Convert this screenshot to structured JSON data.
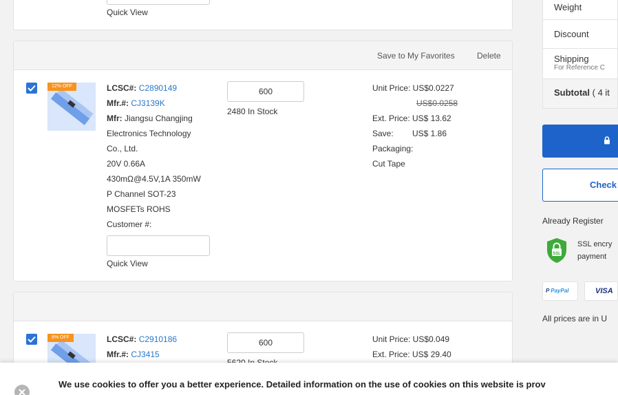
{
  "item0": {
    "quick_view": "Quick View"
  },
  "item1": {
    "actions": {
      "favorites": "Save to My Favorites",
      "delete": "Delete"
    },
    "badge": "12% OFF",
    "lcsc_label": "LCSC#:",
    "lcsc": "C2890149",
    "mfrno_label": "Mfr.#:",
    "mfrno": "CJ3139K",
    "mfr_label": "Mfr:",
    "mfr_lines": [
      "Jiangsu Changjing",
      "Electronics Technology",
      "Co., Ltd."
    ],
    "desc_lines": [
      "20V 0.66A",
      "430mΩ@4.5V,1A 350mW",
      "P Channel SOT-23",
      "MOSFETs ROHS"
    ],
    "customer_label": "Customer #:",
    "quick_view": "Quick View",
    "qty": "600",
    "stock": "2480 In Stock",
    "unit_price": "Unit Price: US$0.0227",
    "old_price": "US$0.0258",
    "ext_price": "Ext. Price: US$ 13.62",
    "save_label": "Save:",
    "save_value": "US$ 1.86",
    "packaging_label": "Packaging:",
    "packaging": "Cut Tape"
  },
  "item2": {
    "badge": "8% OFF",
    "lcsc_label": "LCSC#:",
    "lcsc": "C2910186",
    "mfrno_label": "Mfr.#:",
    "mfrno": "CJ3415",
    "qty": "600",
    "stock": "5620 In Stock",
    "unit_price": "Unit Price: US$0.049",
    "ext_price": "Ext. Price: US$ 29.40"
  },
  "summary": {
    "weight": "Weight",
    "discount": "Discount",
    "shipping": "Shipping",
    "shipping_note": "For Reference C",
    "subtotal": "Subtotal",
    "subtotal_count": "( 4 it",
    "checkout": "Check",
    "already": "Already Register",
    "ssl_text": "SSL encry",
    "ssl_sub": "payment",
    "paypal": "PayPal",
    "visa": "VISA",
    "prices_note": "All prices are in U"
  },
  "cookie": {
    "text": "We use cookies to offer you a better experience. Detailed information on the use of cookies on this website is prov"
  },
  "colors": {
    "accent": "#1e63c9",
    "link": "#2a77c9",
    "badge": "#f7931e"
  }
}
